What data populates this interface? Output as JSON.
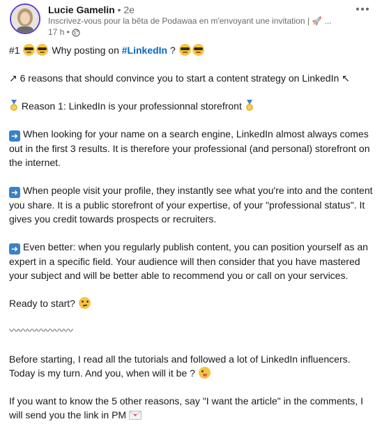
{
  "post": {
    "author": {
      "name": "Lucie Gamelin",
      "degree": "• 2e",
      "headline": "Inscrivez-vous pour la bêta de Podawaa en m'envoyant une invitation | 🚀 ...",
      "time": "17 h •"
    },
    "lines": {
      "title_prefix": "#1",
      "title_mid": "Why posting on",
      "title_hashtag": "#LinkedIn",
      "title_suffix": "?",
      "reasons": "↗ 6 reasons that should convince you to start a content strategy on LinkedIn ↖",
      "reason1": "Reason 1: LinkedIn is your professionnal storefront",
      "p1": "When looking for your name on a search engine, LinkedIn almost always comes out in the first 3 results. It is therefore your professional (and personal) storefront on the internet.",
      "p2": "When people visit your profile, they instantly see what you're into and the content you share. It is a public storefront of your expertise, of your \"professional status\". It gives you credit towards prospects or recruiters.",
      "p3": "Even better: when you regularly publish content, you can position yourself as an expert in a specific field. Your audience will then consider that you have mastered your subject and will be better able to recommend you or call on your services.",
      "ready": "Ready to start?",
      "wave": "〰〰〰〰〰〰〰",
      "before": "Before starting, I read all the tutorials and followed a lot of LinkedIn influencers. Today is my turn. And you, when will it be ?",
      "ifyou": "If you want to know the 5 other reasons, say \"I want the article\" in the comments, I will send you the link in PM"
    }
  },
  "icons": {
    "globe": "globe-icon",
    "more": "more-options-icon",
    "arrow": "right-arrow-icon"
  },
  "colors": {
    "hashtag": "#0a66c2",
    "avatar_ring": "#5b3fd1"
  }
}
